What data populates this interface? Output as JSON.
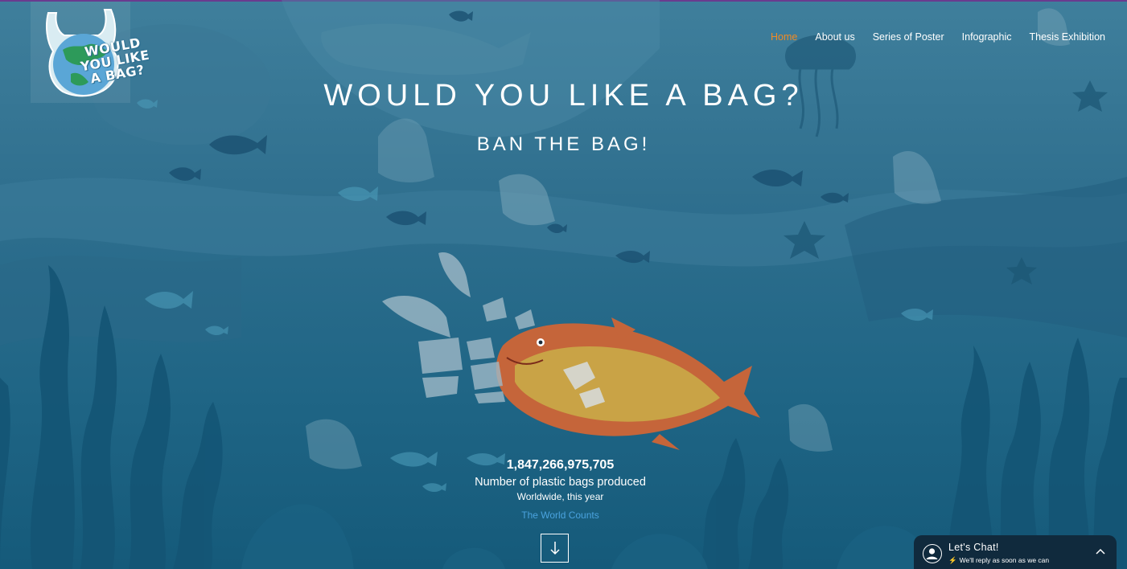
{
  "logo": {
    "text": "WOULD YOU LIKE A BAG?"
  },
  "nav": {
    "items": [
      {
        "label": "Home",
        "active": true
      },
      {
        "label": "About us",
        "active": false
      },
      {
        "label": "Series of Poster",
        "active": false
      },
      {
        "label": "Infographic",
        "active": false
      },
      {
        "label": "Thesis Exhibition",
        "active": false
      }
    ]
  },
  "hero": {
    "title": "WOULD YOU LIKE A BAG?",
    "subtitle": "BAN THE BAG!"
  },
  "counter": {
    "number": "1,847,266,975,705",
    "label": "Number of plastic bags produced",
    "sublabel": "Worldwide, this year",
    "source": "The World Counts"
  },
  "chat": {
    "title": "Let's Chat!",
    "subtitle": "We'll reply as soon as we can"
  },
  "colors": {
    "accent": "#f08a24",
    "background": "#2f6f8e",
    "link": "#4aa3df",
    "chat_bg": "#102a3d"
  },
  "icons": {
    "scroll": "arrow-down-icon",
    "chat": "user-avatar-icon",
    "reply": "lightning-icon",
    "expand": "chevron-up-icon"
  }
}
